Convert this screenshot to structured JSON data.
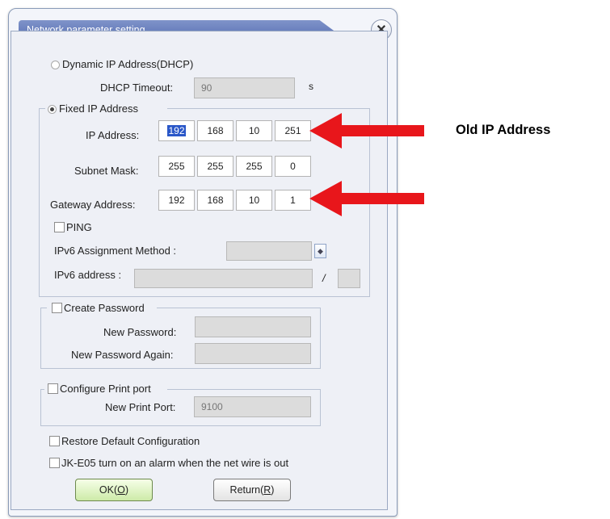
{
  "window": {
    "title": "Network parameter setting",
    "close_glyph": "✕"
  },
  "dhcp": {
    "radio_label": "Dynamic IP Address(DHCP)",
    "selected": false,
    "timeout_label": "DHCP Timeout:",
    "timeout_value": "90",
    "timeout_unit": "s"
  },
  "fixed": {
    "radio_label": "Fixed IP Address",
    "selected": true,
    "ip_label": "IP Address:",
    "ip": [
      "192",
      "168",
      "10",
      "251"
    ],
    "mask_label": "Subnet Mask:",
    "mask": [
      "255",
      "255",
      "255",
      "0"
    ],
    "gateway_label": "Gateway Address:",
    "gateway": [
      "192",
      "168",
      "10",
      "1"
    ],
    "ping_label": "PING",
    "ping_checked": false,
    "ipv6_method_label": "IPv6 Assignment Method :",
    "ipv6_method_value": "",
    "ipv6_address_label": "IPv6 address :",
    "ipv6_address_value": "",
    "ipv6_slash": "/",
    "ipv6_prefix_value": ""
  },
  "password": {
    "checkbox_label": "Create Password",
    "checked": false,
    "new_label": "New Password:",
    "new_value": "",
    "again_label": "New Password Again:",
    "again_value": ""
  },
  "print_port": {
    "checkbox_label": "Configure Print port",
    "checked": false,
    "new_label": "New Print Port:",
    "value": "9100"
  },
  "restore": {
    "label": "Restore Default Configuration",
    "checked": false
  },
  "alarm": {
    "label": "JK-E05 turn on an alarm when the net wire is out",
    "checked": false
  },
  "buttons": {
    "ok_text": "OK(",
    "ok_key": "O",
    "ok_end": ")",
    "return_text": "Return(",
    "return_key": "R",
    "return_end": ")"
  },
  "annotation": {
    "callout_text": "Old IP Address",
    "arrow_color": "#e8161b"
  }
}
